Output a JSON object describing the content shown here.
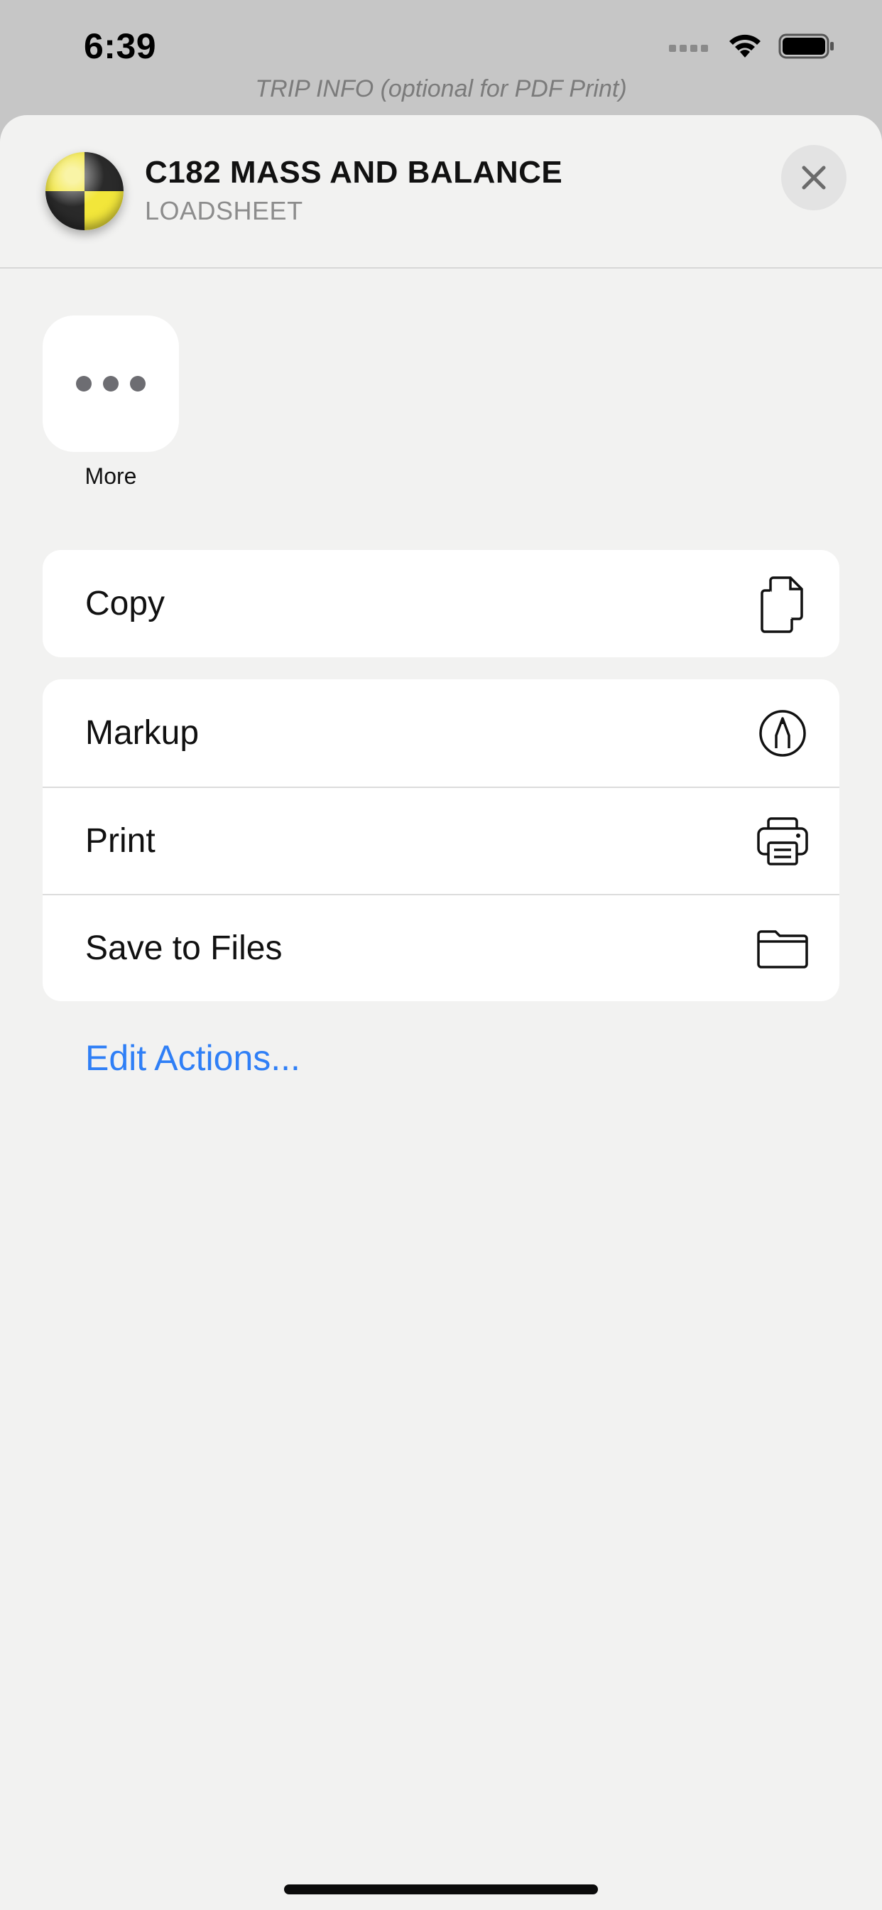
{
  "status_bar": {
    "time": "6:39"
  },
  "background": {
    "subtitle": "TRIP INFO (optional for PDF Print)"
  },
  "sheet": {
    "title": "C182 MASS AND BALANCE",
    "subtitle": "LOADSHEET",
    "more_label": "More",
    "groups": [
      [
        {
          "label": "Copy",
          "icon": "copy-icon"
        }
      ],
      [
        {
          "label": "Markup",
          "icon": "markup-icon"
        },
        {
          "label": "Print",
          "icon": "printer-icon"
        },
        {
          "label": "Save to Files",
          "icon": "folder-icon"
        }
      ]
    ],
    "edit_actions": "Edit Actions..."
  },
  "colors": {
    "accent": "#2f7ff6",
    "sheet_bg": "#f2f2f1",
    "row_bg": "#ffffff"
  }
}
